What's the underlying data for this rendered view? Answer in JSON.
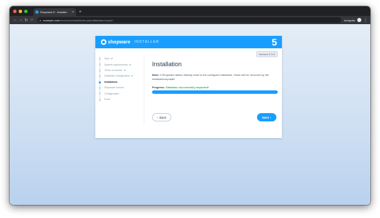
{
  "browser": {
    "tab_title": "Shopware 5 - Installer",
    "tab_close": "×",
    "new_tab": "+",
    "nav_back": "←",
    "nav_forward": "→",
    "nav_reload": "↻",
    "nav_home": "⌂",
    "lock": "🔒",
    "url_host": "example.com",
    "url_path": "/recovery/install/index.php/database-import/",
    "incognito_label": "Incognito",
    "menu": "⋮",
    "traffic_colors": [
      "#ff5f57",
      "#febc2e",
      "#28c840"
    ]
  },
  "installer": {
    "logo_text": "shopware",
    "header_label": "INSTALLER",
    "version_big": "5",
    "version_badge": "Version 5.3.0",
    "accent": "#189eff",
    "steps": [
      {
        "label": "Start",
        "check": "✔"
      },
      {
        "label": "System requirements",
        "check": "✔"
      },
      {
        "label": "Terms of service",
        "check": "✔"
      },
      {
        "label": "Database configuration",
        "check": "✔"
      },
      {
        "label": "Installation",
        "check": ""
      },
      {
        "label": "Shopware licence",
        "check": ""
      },
      {
        "label": "Configuration",
        "check": ""
      },
      {
        "label": "Done",
        "check": ""
      }
    ],
    "active_step": 4,
    "title": "Installation",
    "note_strong": "Note:",
    "note_text": " If Shopware tables already exist in the configured database, these will be removed by the installation/update!",
    "progress_label": "Progress:",
    "progress_status": "Database successfully imported!",
    "progress_value": 1.0,
    "back_icon": "‹",
    "back_label": "Back",
    "next_label": "Next",
    "next_icon": "›"
  }
}
